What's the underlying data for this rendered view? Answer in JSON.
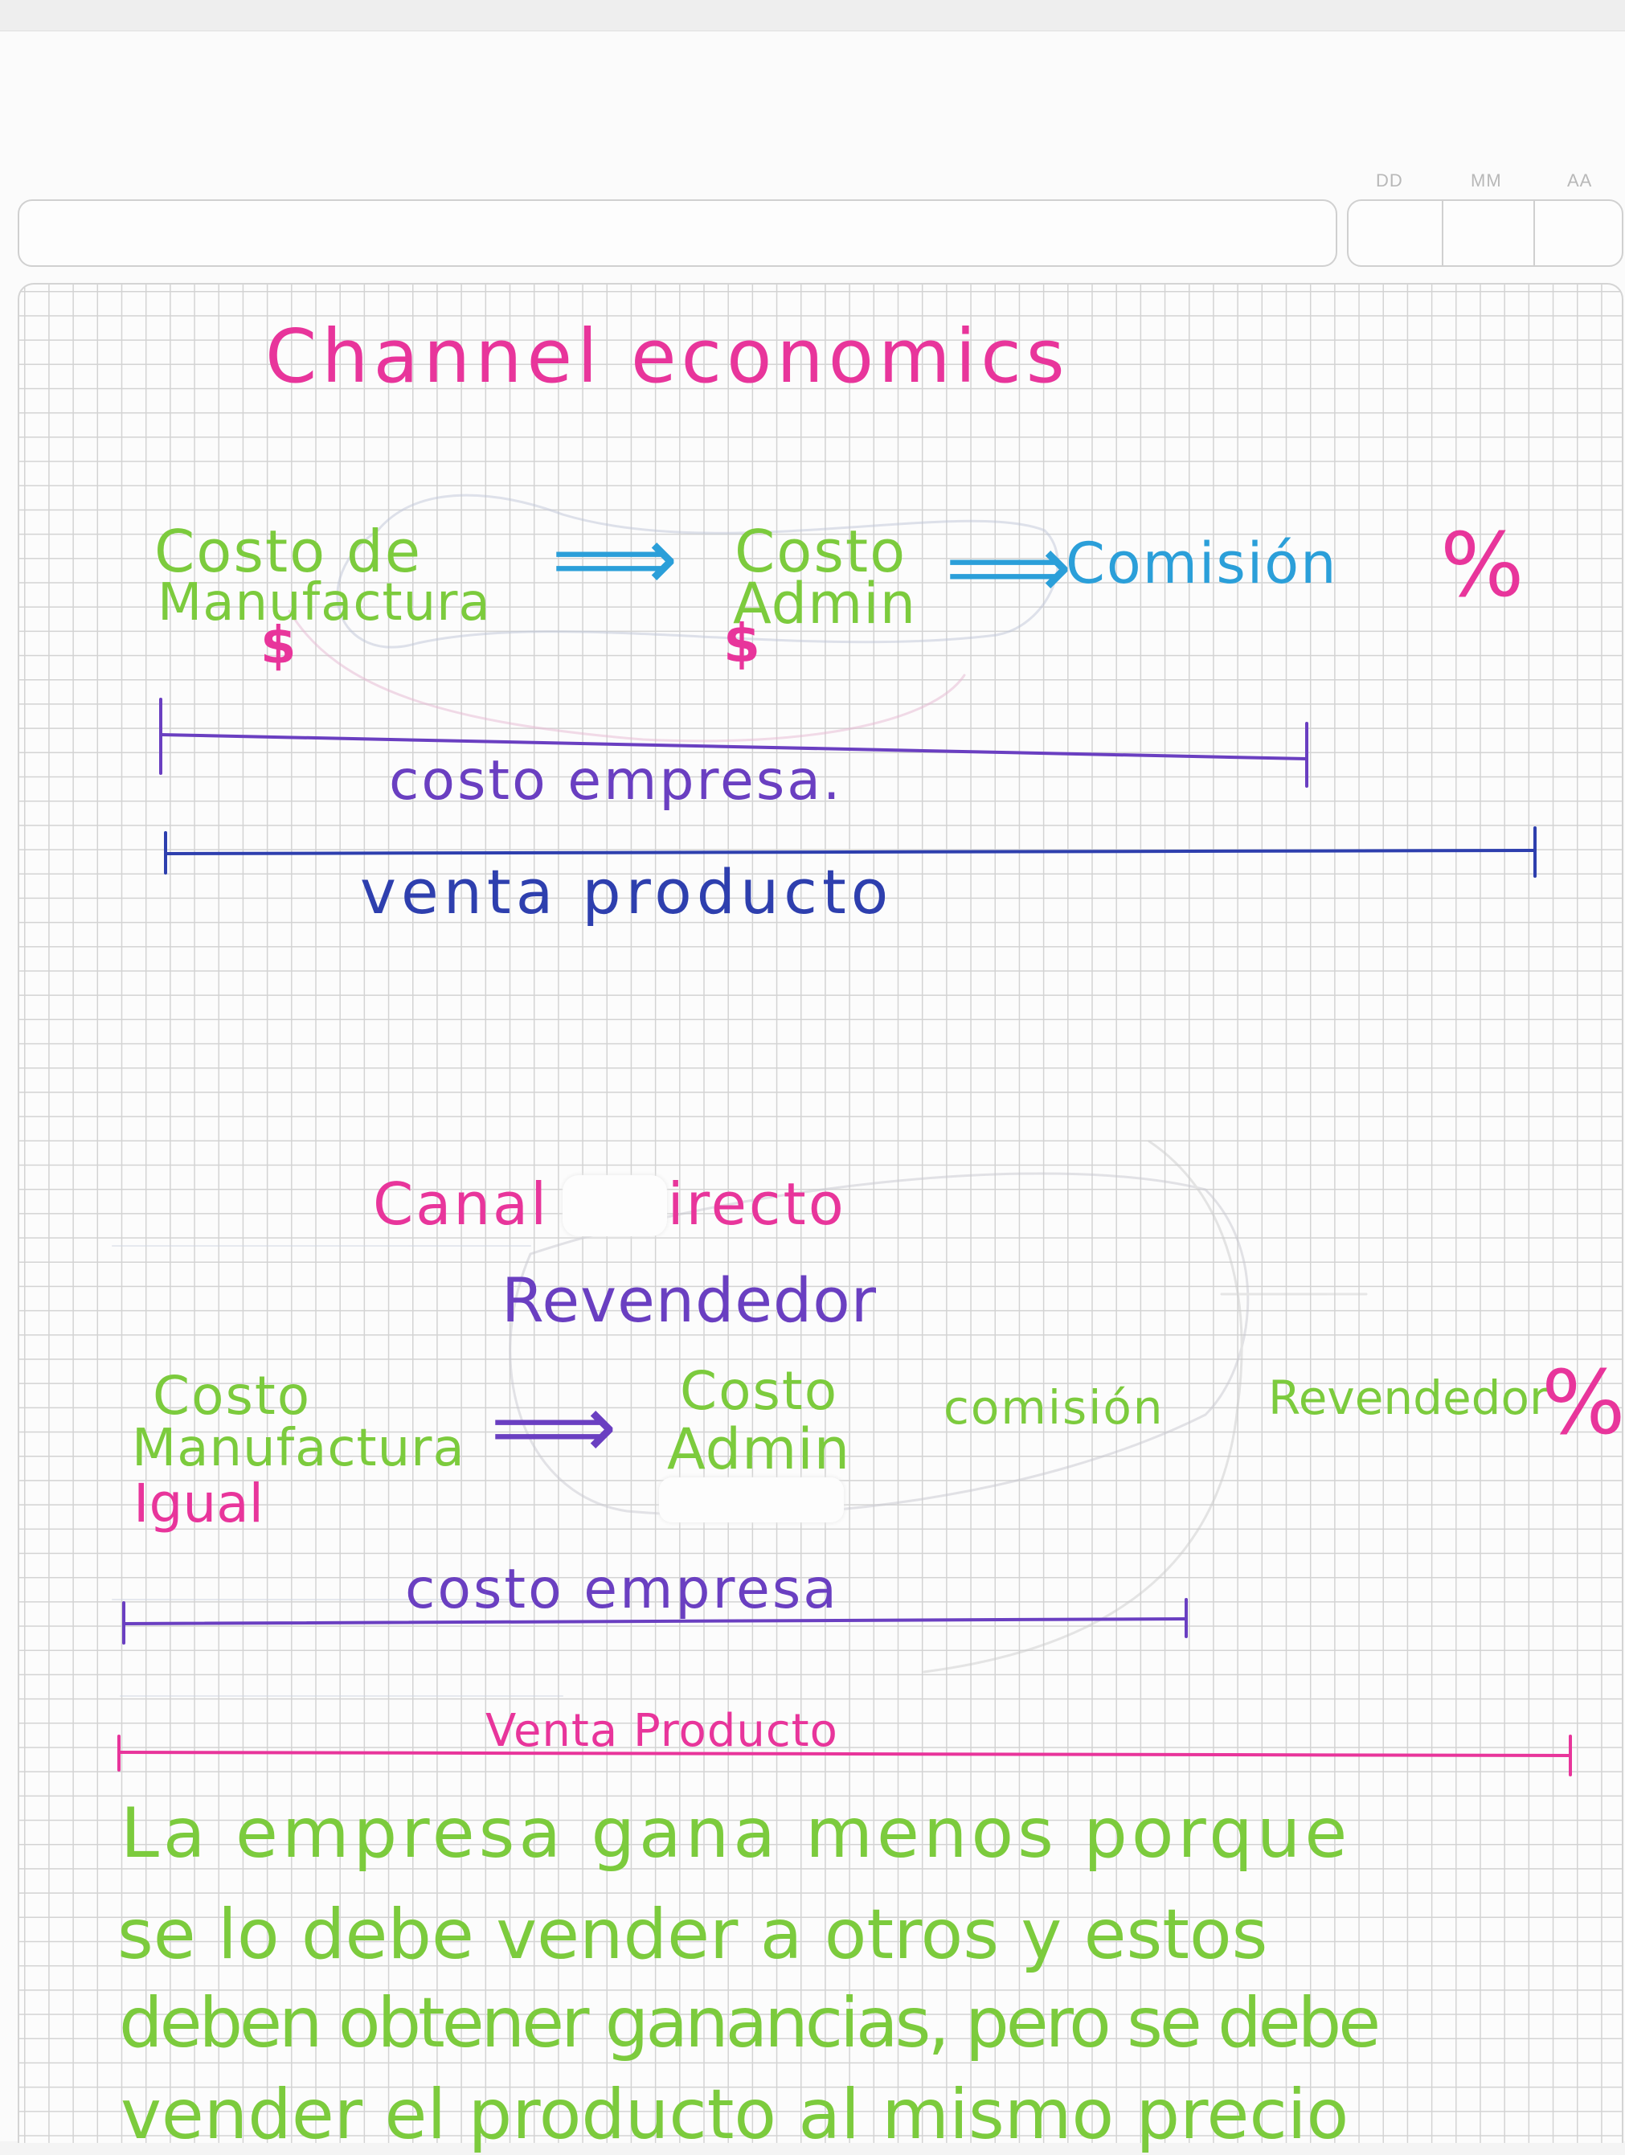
{
  "header": {
    "date_labels": {
      "day": "DD",
      "month": "MM",
      "year": "AA"
    }
  },
  "section1": {
    "title": "Channel economics",
    "cost_manufacture_line1": "Costo de",
    "cost_manufacture_line2": "Manufactura",
    "dollar_1": "$",
    "arrow_1": "⟹",
    "cost_admin_line1": "Costo",
    "cost_admin_line2": "Admin",
    "dollar_2": "$",
    "arrow_2": "⟹",
    "commission": "Comisión",
    "percent": "%",
    "bar_company_cost": "costo empresa.",
    "bar_product_sale": "venta producto"
  },
  "section2": {
    "title": "Canal Indirecto",
    "subtitle": "Revendedor",
    "cost_manufacture_line1": "Costo",
    "cost_manufacture_line2": "Manufactura",
    "equal_note": "Igual",
    "arrow": "⟹",
    "cost_admin_line1": "Costo",
    "cost_admin_line2": "Admin",
    "commission": "comisión",
    "reseller": "Revendedor",
    "percent": "%",
    "bar_company_cost": "costo empresa",
    "bar_product_sale": "Venta Producto"
  },
  "conclusion": {
    "line1": "La empresa gana menos porque",
    "line2": "se lo debe vender a otros y estos",
    "line3": "deben obtener ganancias, pero se debe",
    "line4": "vender el producto al mismo precio"
  },
  "colors": {
    "pink": "#e8359b",
    "green": "#7ccb3d",
    "blue": "#2b9fd9",
    "purple": "#6a3fc1",
    "navy": "#2e3fae"
  }
}
